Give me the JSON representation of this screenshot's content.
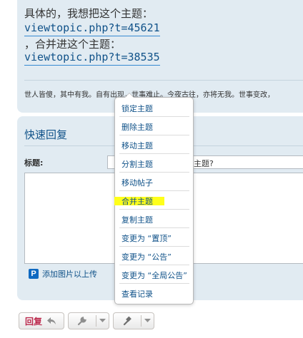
{
  "post": {
    "line1": "具体的，我想把这个主题：",
    "link1": "viewtopic.php?t=45621",
    "line2": "，合并进这个主题：",
    "link2": "viewtopic.php?t=38535",
    "signature": "世人皆傻，其中有我。自有出现，世事难止。今夜古往，亦将无我。世事变改，"
  },
  "quick_reply": {
    "title": "快速回复",
    "subject_label": "标题:",
    "subject_value": "主题?",
    "attach_icon_glyph": "P",
    "attach_label": "添加图片以上传"
  },
  "buttons": {
    "reply_label": "回复"
  },
  "dropdown": {
    "items": [
      "锁定主题",
      "删除主题",
      "移动主题",
      "分割主题",
      "移动帖子",
      "合并主题",
      "复制主题",
      "变更为 “置顶”",
      "变更为 “公告”",
      "变更为 “全局公告”",
      "查看记录"
    ],
    "highlighted_index": 5
  },
  "colors": {
    "panel": "#e1ebf2",
    "link": "#105289",
    "reply": "#bc2a4d",
    "highlight": "#ffff1a"
  }
}
